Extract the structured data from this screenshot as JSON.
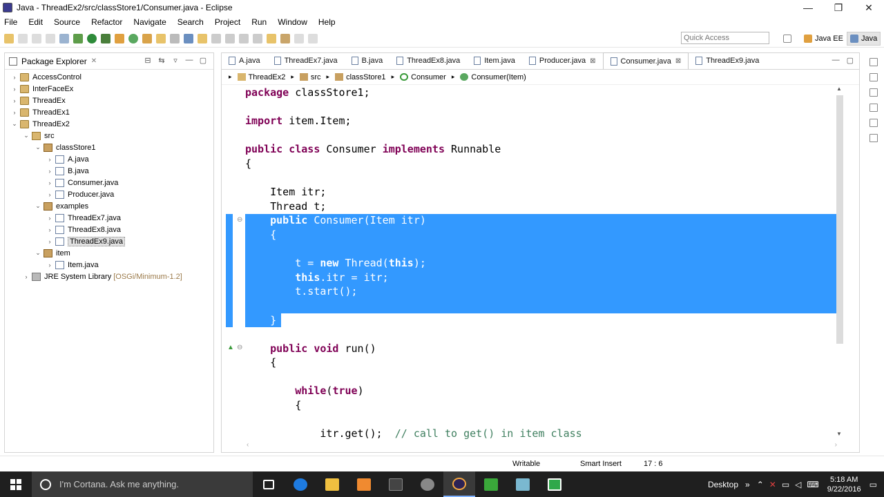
{
  "window": {
    "title": "Java - ThreadEx2/src/classStore1/Consumer.java - Eclipse",
    "minimize": "—",
    "maximize": "❐",
    "close": "✕"
  },
  "menu": [
    "File",
    "Edit",
    "Source",
    "Refactor",
    "Navigate",
    "Search",
    "Project",
    "Run",
    "Window",
    "Help"
  ],
  "toolbar": {
    "quick_access_placeholder": "Quick Access",
    "perspectives": [
      "Java EE",
      "Java"
    ]
  },
  "package_explorer": {
    "title": "Package Explorer",
    "tree": [
      {
        "label": "AccessControl",
        "icon": "project-icon",
        "arrow": "›",
        "indent": 0
      },
      {
        "label": "InterFaceEx",
        "icon": "project-icon",
        "arrow": "›",
        "indent": 0
      },
      {
        "label": "ThreadEx",
        "icon": "project-icon",
        "arrow": "›",
        "indent": 0
      },
      {
        "label": "ThreadEx1",
        "icon": "project-icon",
        "arrow": "›",
        "indent": 0
      },
      {
        "label": "ThreadEx2",
        "icon": "project-icon",
        "arrow": "⌄",
        "indent": 0
      },
      {
        "label": "src",
        "icon": "source-folder-icon",
        "arrow": "⌄",
        "indent": 1
      },
      {
        "label": "classStore1",
        "icon": "package-icon",
        "arrow": "⌄",
        "indent": 2
      },
      {
        "label": "A.java",
        "icon": "java-file-icon",
        "arrow": "›",
        "indent": 3
      },
      {
        "label": "B.java",
        "icon": "java-file-icon",
        "arrow": "›",
        "indent": 3
      },
      {
        "label": "Consumer.java",
        "icon": "java-file-icon",
        "arrow": "›",
        "indent": 3
      },
      {
        "label": "Producer.java",
        "icon": "java-file-icon",
        "arrow": "›",
        "indent": 3
      },
      {
        "label": "examples",
        "icon": "package-icon",
        "arrow": "⌄",
        "indent": 2
      },
      {
        "label": "ThreadEx7.java",
        "icon": "java-file-icon",
        "arrow": "›",
        "indent": 3
      },
      {
        "label": "ThreadEx8.java",
        "icon": "java-file-icon",
        "arrow": "›",
        "indent": 3
      },
      {
        "label": "ThreadEx9.java",
        "icon": "java-file-icon",
        "arrow": "›",
        "indent": 3,
        "selected": true
      },
      {
        "label": "item",
        "icon": "package-icon",
        "arrow": "⌄",
        "indent": 2
      },
      {
        "label": "Item.java",
        "icon": "java-file-icon",
        "arrow": "›",
        "indent": 3
      },
      {
        "label": "JRE System Library",
        "suffix": "[OSGi/Minimum-1.2]",
        "icon": "library-icon",
        "arrow": "›",
        "indent": 1
      }
    ]
  },
  "editor": {
    "tabs": [
      {
        "label": "A.java",
        "active": false,
        "closable": false
      },
      {
        "label": "ThreadEx7.java",
        "active": false,
        "closable": false
      },
      {
        "label": "B.java",
        "active": false,
        "closable": false
      },
      {
        "label": "ThreadEx8.java",
        "active": false,
        "closable": false
      },
      {
        "label": "Item.java",
        "active": false,
        "closable": false
      },
      {
        "label": "Producer.java",
        "active": false,
        "closable": true
      },
      {
        "label": "Consumer.java",
        "active": true,
        "closable": true
      },
      {
        "label": "ThreadEx9.java",
        "active": false,
        "closable": false
      }
    ],
    "breadcrumb": [
      "ThreadEx2",
      "src",
      "classStore1",
      "Consumer",
      "Consumer(Item)"
    ],
    "code": {
      "l1_kw": "package",
      "l1_rest": " classStore1;",
      "l2_kw": "import",
      "l2_rest": " item.Item;",
      "l3_kw1": "public",
      "l3_kw2": "class",
      "l3_name": " Consumer ",
      "l3_kw3": "implements",
      "l3_rest": " Runnable",
      "l4": "{",
      "l5": "    Item itr;",
      "l6": "    Thread t;",
      "l7_kw": "public",
      "l7_rest": " Consumer(Item itr)",
      "l8": "    {",
      "l9_a": "        t = ",
      "l9_kw": "new",
      "l9_b": " Thread(",
      "l9_kw2": "this",
      "l9_c": ");",
      "l10_kw": "this",
      "l10_rest": ".itr = itr;",
      "l11": "        t.start();",
      "l12": "    }",
      "l13_kw1": "public",
      "l13_kw2": "void",
      "l13_rest": " run()",
      "l14": "    {",
      "l15_kw": "while",
      "l15_a": "(",
      "l15_kw2": "true",
      "l15_b": ")",
      "l16": "        {",
      "l17_a": "            itr.get();  ",
      "l17_cm": "// call to get() in item class"
    }
  },
  "status": {
    "writable": "Writable",
    "insert_mode": "Smart Insert",
    "position": "17 : 6"
  },
  "taskbar": {
    "cortana": "I'm Cortana. Ask me anything.",
    "desktop": "Desktop",
    "time": "5:18 AM",
    "date": "9/22/2016"
  },
  "colors": {
    "selection": "#3399ff",
    "keyword": "#7f0055",
    "comment": "#3f7f5f"
  }
}
